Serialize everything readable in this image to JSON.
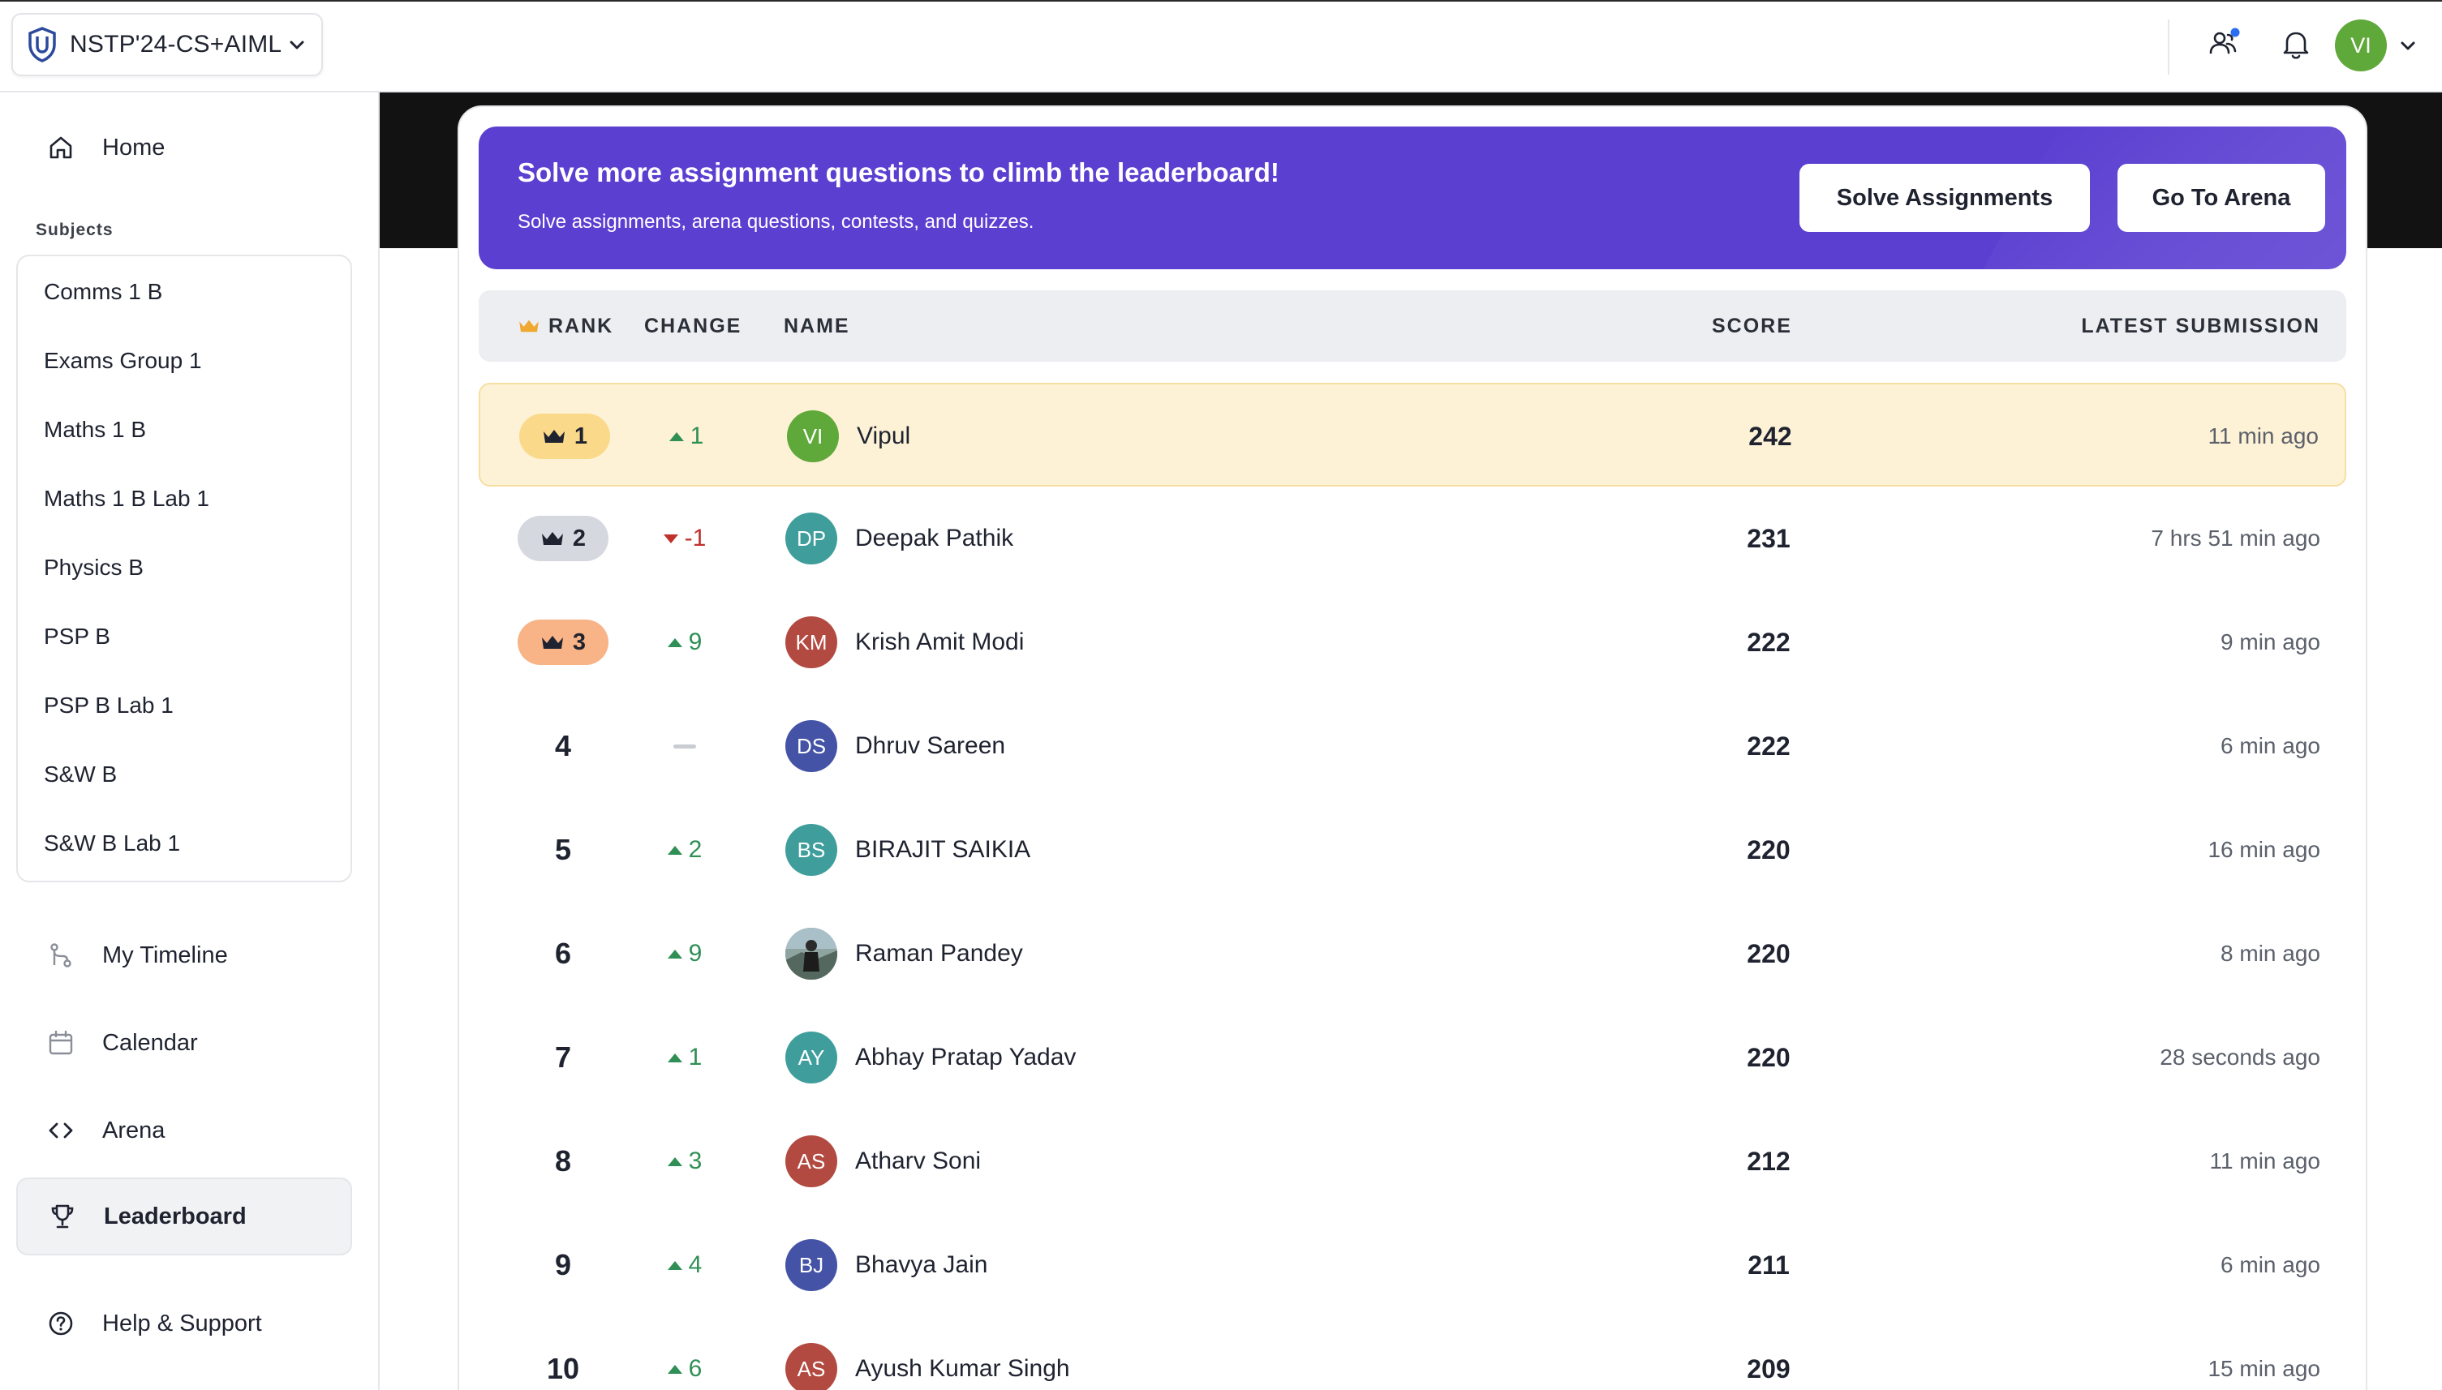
{
  "topbar": {
    "course": "NSTP'24-CS+AIML",
    "user_initials": "VI",
    "icons": [
      "shield-logo-icon",
      "chevron-down-icon",
      "people-icon",
      "bell-icon"
    ],
    "notification_dot_color": "#2b6df2"
  },
  "sidebar": {
    "home": "Home",
    "subjects_heading": "Subjects",
    "subjects": [
      "Comms 1 B",
      "Exams Group 1",
      "Maths 1 B",
      "Maths 1 B Lab 1",
      "Physics B",
      "PSP B",
      "PSP B Lab 1",
      "S&W B",
      "S&W B Lab 1"
    ],
    "timeline": "My Timeline",
    "calendar": "Calendar",
    "arena": "Arena",
    "leaderboard": "Leaderboard",
    "help": "Help & Support",
    "active_item": "Leaderboard"
  },
  "banner": {
    "title": "Solve more assignment questions to climb the leaderboard!",
    "subtitle": "Solve assignments, arena questions, contests, and quizzes.",
    "btn_assignments": "Solve Assignments",
    "btn_arena": "Go To Arena",
    "color": "#5b3fd1"
  },
  "table": {
    "headers": {
      "rank": "RANK",
      "change": "CHANGE",
      "name": "NAME",
      "score": "SCORE",
      "latest": "LATEST SUBMISSION"
    },
    "rows": [
      {
        "rank": "1",
        "change": "1",
        "dir": "up",
        "initials": "VI",
        "avatar_color": "#5fa83a",
        "name": "Vipul",
        "score": "242",
        "latest": "11 min ago"
      },
      {
        "rank": "2",
        "change": "-1",
        "dir": "down",
        "initials": "DP",
        "avatar_color": "#3f9e9b",
        "name": "Deepak Pathik",
        "score": "231",
        "latest": "7 hrs 51 min ago"
      },
      {
        "rank": "3",
        "change": "9",
        "dir": "up",
        "initials": "KM",
        "avatar_color": "#b34a41",
        "name": "Krish Amit Modi",
        "score": "222",
        "latest": "9 min ago"
      },
      {
        "rank": "4",
        "change": "",
        "dir": "none",
        "initials": "DS",
        "avatar_color": "#4453a6",
        "name": "Dhruv Sareen",
        "score": "222",
        "latest": "6 min ago"
      },
      {
        "rank": "5",
        "change": "2",
        "dir": "up",
        "initials": "BS",
        "avatar_color": "#3f9e9b",
        "name": "BIRAJIT SAIKIA",
        "score": "220",
        "latest": "16 min ago"
      },
      {
        "rank": "6",
        "change": "9",
        "dir": "up",
        "initials": "",
        "avatar_color": "#6b7f7a",
        "name": "Raman Pandey",
        "score": "220",
        "latest": "8 min ago"
      },
      {
        "rank": "7",
        "change": "1",
        "dir": "up",
        "initials": "AY",
        "avatar_color": "#3f9e9b",
        "name": "Abhay Pratap Yadav",
        "score": "220",
        "latest": "28 seconds ago"
      },
      {
        "rank": "8",
        "change": "3",
        "dir": "up",
        "initials": "AS",
        "avatar_color": "#b34a41",
        "name": "Atharv Soni",
        "score": "212",
        "latest": "11 min ago"
      },
      {
        "rank": "9",
        "change": "4",
        "dir": "up",
        "initials": "BJ",
        "avatar_color": "#4453a6",
        "name": "Bhavya Jain",
        "score": "211",
        "latest": "6 min ago"
      },
      {
        "rank": "10",
        "change": "6",
        "dir": "up",
        "initials": "AS",
        "avatar_color": "#b34a41",
        "name": "Ayush Kumar Singh",
        "score": "209",
        "latest": "15 min ago"
      }
    ],
    "medal_colors": [
      "#fbd98a",
      "#d5d8de",
      "#f8b387"
    ]
  }
}
